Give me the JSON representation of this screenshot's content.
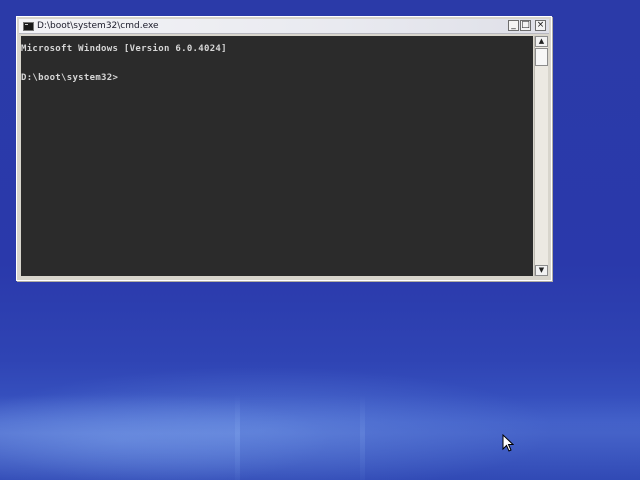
{
  "window": {
    "title": "D:\\boot\\system32\\cmd.exe",
    "controls": {
      "minimize": "_",
      "maximize": "□",
      "close": "×"
    }
  },
  "console": {
    "lines": [
      "Microsoft Windows [Version 6.0.4024]",
      "D:\\boot\\system32>"
    ]
  },
  "scrollbar": {
    "up_arrow": "▲",
    "down_arrow": "▼"
  },
  "icons": {
    "app": "cmd-console-icon",
    "cursor": "mouse-pointer-icon"
  },
  "colors": {
    "desktop": "#2a39ab",
    "console_bg": "#2b2b2b",
    "console_text": "#d7d7d7"
  }
}
